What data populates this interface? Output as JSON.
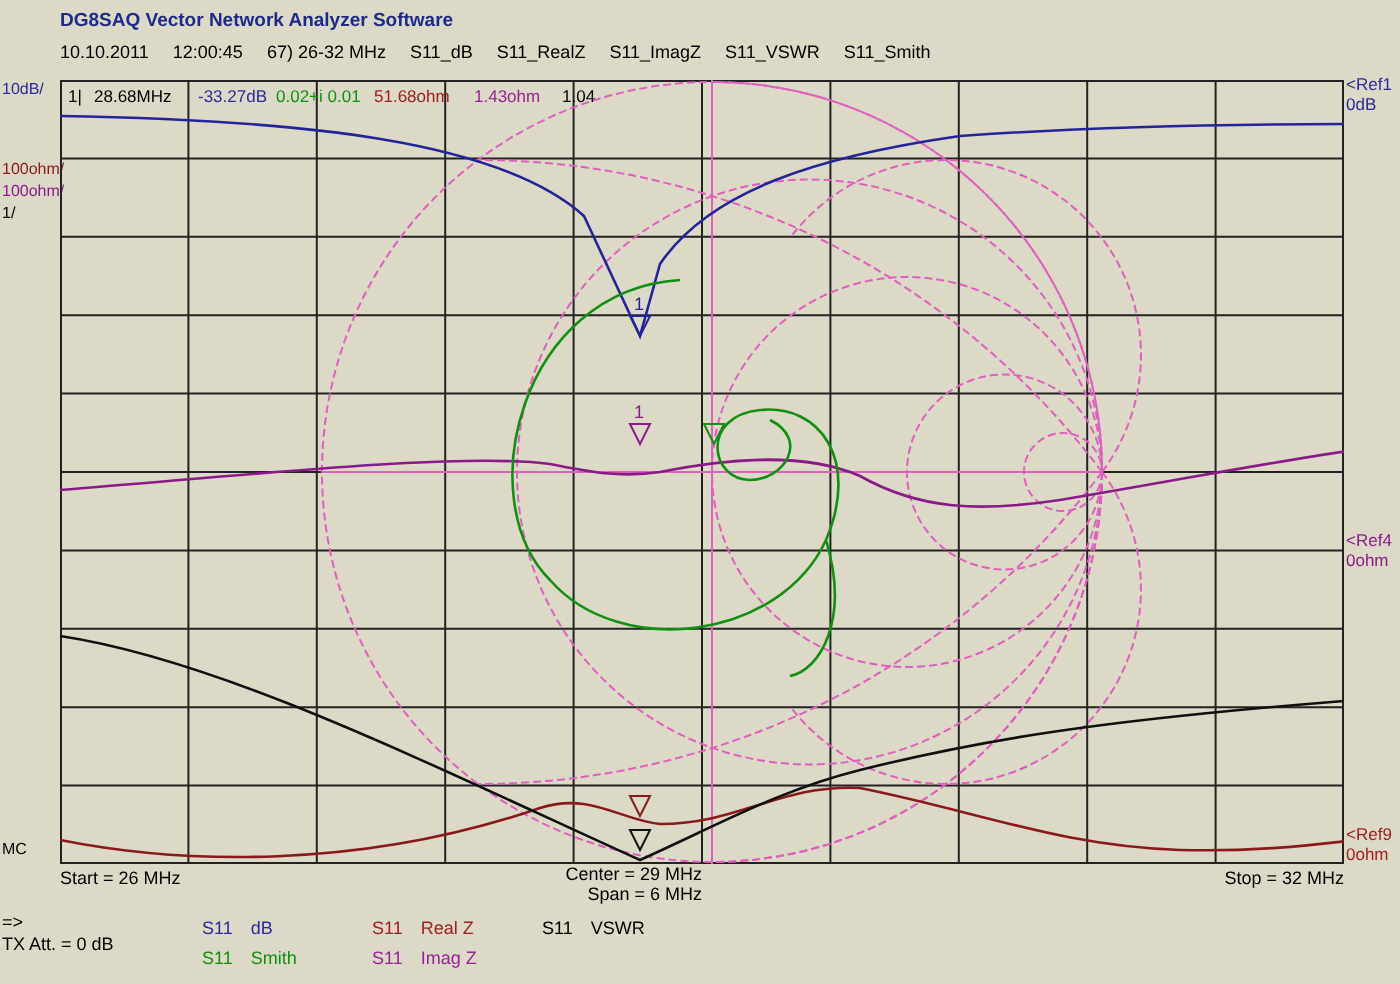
{
  "title": "DG8SAQ Vector Network Analyzer Software",
  "info": [
    "10.10.2011",
    "12:00:45",
    "67) 26-32 MHz",
    "S11_dB",
    "S11_RealZ",
    "S11_ImagZ",
    "S11_VSWR",
    "S11_Smith"
  ],
  "left_scales": [
    {
      "text": "10dB/",
      "color": "#2a2a9a"
    },
    {
      "text": "100ohm/",
      "color": "#8a1a1a"
    },
    {
      "text": "100ohm/",
      "color": "#8a1a8a"
    },
    {
      "text": "1/",
      "color": "#000000"
    },
    {
      "text": "MC",
      "color": "#000000"
    }
  ],
  "readout": [
    {
      "text": "1|",
      "color": "#000000"
    },
    {
      "text": "28.68MHz",
      "color": "#000000"
    },
    {
      "text": "-33.27dB",
      "color": "#2a2a9a"
    },
    {
      "text": "0.02+i 0.01",
      "color": "#109010"
    },
    {
      "text": "51.68ohm",
      "color": "#a02020"
    },
    {
      "text": "1.43ohm",
      "color": "#9a209a"
    },
    {
      "text": "1.04",
      "color": "#000000"
    }
  ],
  "right_refs": [
    {
      "name": "<Ref1",
      "value": "0dB",
      "color": "#2a2a9a"
    },
    {
      "name": "<Ref4",
      "value": "0ohm",
      "color": "#8a1a8a"
    },
    {
      "name": "<Ref9",
      "value": "0ohm",
      "color": "#a02020"
    }
  ],
  "markers": [
    {
      "kind": "db",
      "label": "1"
    },
    {
      "kind": "imag",
      "label": "1"
    },
    {
      "kind": "smith"
    },
    {
      "kind": "real"
    },
    {
      "kind": "vswr"
    }
  ],
  "axis": {
    "start": "Start = 26 MHz",
    "center": "Center = 29 MHz",
    "span": "Span = 6 MHz",
    "stop": "Stop = 32 MHz"
  },
  "status": [
    "=>",
    "TX Att. = 0 dB"
  ],
  "legend": [
    {
      "param": "S11",
      "name": "dB",
      "color": "#2a2aa0"
    },
    {
      "param": "S11",
      "name": "Smith",
      "color": "#109010"
    },
    {
      "param": "S11",
      "name": "Real Z",
      "color": "#a02020"
    },
    {
      "param": "S11",
      "name": "Imag Z",
      "color": "#9a209a"
    },
    {
      "param": "S11",
      "name": "VSWR",
      "color": "#000000"
    }
  ]
}
